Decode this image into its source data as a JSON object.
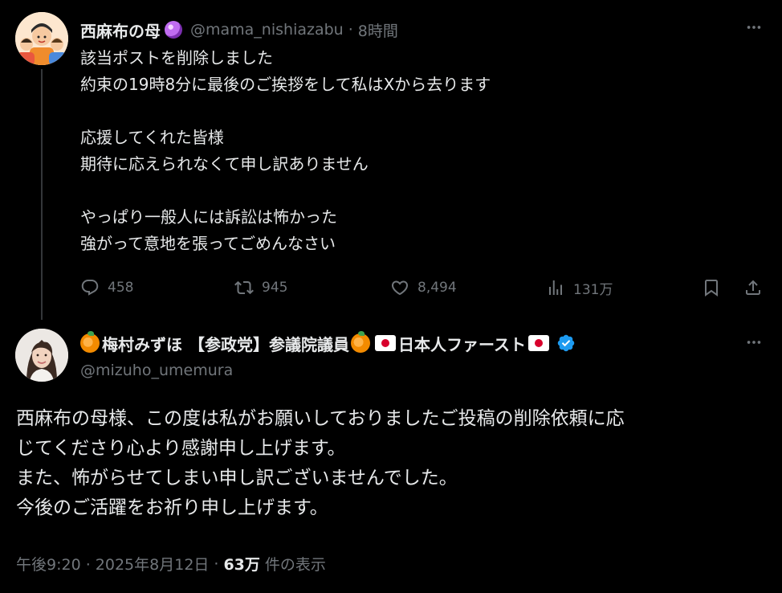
{
  "post1": {
    "author_name": "西麻布の母",
    "handle": "@mama_nishiazabu",
    "separator": "·",
    "time": "8時間",
    "lines": [
      "該当ポストを削除しました",
      "約束の19時8分に最後のご挨拶をして私はXから去ります",
      "",
      "応援してくれた皆様",
      "期待に応えられなくて申し訳ありません",
      "",
      "やっぱり一般人には訴訟は怖かった",
      "強がって意地を張ってごめんなさい"
    ],
    "stats": {
      "replies": "458",
      "reposts": "945",
      "likes": "8,494",
      "views": "131万"
    }
  },
  "post2": {
    "author_name_part1": "梅村みずほ",
    "author_name_part2": "【参政党】参議院議員",
    "author_name_part3": "日本人ファースト",
    "handle": "@mizuho_umemura",
    "lines": [
      "西麻布の母様、この度は私がお願いしておりましたご投稿の削除依頼に応",
      "じてくださり心より感謝申し上げます。",
      "また、怖がらせてしまい申し訳ございませんでした。",
      "今後のご活躍をお祈り申し上げます。"
    ],
    "timestamp": "午後9:20 · 2025年8月12日",
    "separator": "·",
    "views_count": "63万",
    "views_label": "件の表示"
  },
  "icons": {
    "more": "more-icon",
    "reply": "reply-icon",
    "repost": "repost-icon",
    "like": "heart-icon",
    "views": "views-icon",
    "bookmark": "bookmark-icon",
    "share": "share-icon",
    "verified": "verified-badge-icon"
  },
  "colors": {
    "background": "#000000",
    "text": "#e7e9ea",
    "muted": "#71767b",
    "verified": "#1d9bf0"
  }
}
